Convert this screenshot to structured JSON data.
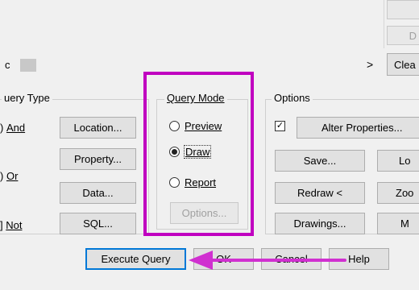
{
  "top": {
    "button_cut_1": "",
    "button_cut_2": "D",
    "search_partial_char": "c",
    "chevron": ">",
    "clear_button": "Clea"
  },
  "query_type": {
    "legend": "uery Type",
    "and_label": "And",
    "or_label": "Or",
    "not_label": "Not",
    "location_button": "Location...",
    "property_button": "Property...",
    "data_button": "Data...",
    "sql_button": "SQL..."
  },
  "query_mode": {
    "legend": "Query Mode",
    "preview_label": "Preview",
    "draw_label": "Draw",
    "report_label": "Report",
    "options_button": "Options...",
    "selected": "Draw"
  },
  "options": {
    "legend": "Options",
    "alter_properties_button": "Alter Properties...",
    "save_button": "Save...",
    "redraw_button": "Redraw <",
    "drawings_button": "Drawings...",
    "right_col_1": "Lo",
    "right_col_2": "Zoo",
    "right_col_3": "M"
  },
  "bottom": {
    "execute_query_button": "Execute Query",
    "ok_button": "OK",
    "cancel_button": "Cancel",
    "help_button": "Help"
  },
  "colors": {
    "highlight": "#c000c0",
    "arrow": "#d030d0"
  }
}
